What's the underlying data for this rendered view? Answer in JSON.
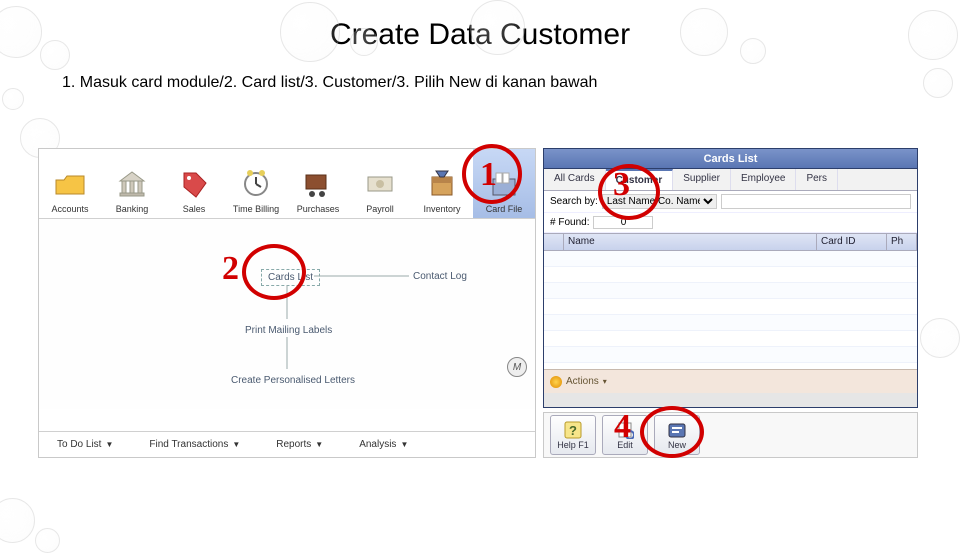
{
  "title": "Create Data Customer",
  "steps_text": "1. Masuk card module/2. Card list/3. Customer/3. Pilih New di kanan bawah",
  "toolbar": [
    {
      "label": "Accounts"
    },
    {
      "label": "Banking"
    },
    {
      "label": "Sales"
    },
    {
      "label": "Time Billing"
    },
    {
      "label": "Purchases"
    },
    {
      "label": "Payroll"
    },
    {
      "label": "Inventory"
    },
    {
      "label": "Card File"
    }
  ],
  "flowchart": {
    "cards_list": "Cards List",
    "contact_log": "Contact Log",
    "print_mailing": "Print Mailing Labels",
    "create_letters": "Create Personalised Letters"
  },
  "bottom_bar": {
    "todo": "To Do List",
    "find": "Find Transactions",
    "reports": "Reports",
    "analysis": "Analysis"
  },
  "m_badge": "M",
  "right_win": {
    "title": "Cards List",
    "tabs": [
      "All Cards",
      "Customer",
      "Supplier",
      "Employee",
      "Pers"
    ],
    "active_tab": 1,
    "search_by_label": "Search by:",
    "search_by_value": "Last Name/Co. Name",
    "search_placeholder": "",
    "found_label": "# Found:",
    "found_value": "0",
    "grid_headers": [
      "",
      "Name",
      "Card ID",
      "Ph"
    ],
    "actions_label": "Actions"
  },
  "right_buttons": {
    "help": "Help F1",
    "edit": "Edit",
    "new": "New"
  },
  "callouts": {
    "1": "1",
    "2": "2",
    "3": "3",
    "4": "4"
  }
}
